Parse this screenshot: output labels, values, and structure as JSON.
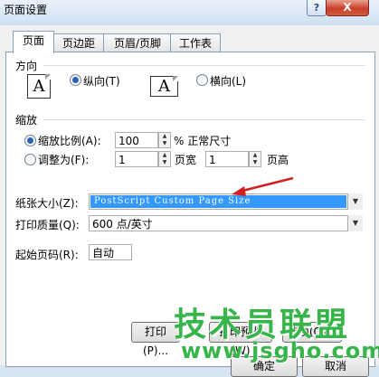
{
  "window": {
    "title": "页面设置",
    "help_label": "?",
    "close_label": "X"
  },
  "tabs": [
    {
      "label": "页面",
      "active": true
    },
    {
      "label": "页边距",
      "active": false
    },
    {
      "label": "页眉/页脚",
      "active": false
    },
    {
      "label": "工作表",
      "active": false
    }
  ],
  "orientation": {
    "group_label": "方向",
    "portrait_icon": "A",
    "portrait_label": "纵向(T)",
    "portrait_selected": true,
    "landscape_icon": "A",
    "landscape_label": "横向(L)",
    "landscape_selected": false
  },
  "scaling": {
    "group_label": "缩放",
    "adjust_label": "缩放比例(A):",
    "adjust_selected": true,
    "adjust_value": "100",
    "adjust_suffix": "% 正常尺寸",
    "fit_label": "调整为(F):",
    "fit_selected": false,
    "fit_wide_value": "1",
    "fit_wide_suffix": "页宽",
    "fit_tall_value": "1",
    "fit_tall_suffix": "页高"
  },
  "paper_size": {
    "label": "纸张大小(Z):",
    "value": "PostScript Custom Page Size"
  },
  "print_quality": {
    "label": "打印质量(Q):",
    "value": "600 点/英寸"
  },
  "first_page": {
    "label": "起始页码(R):",
    "value": "自动"
  },
  "buttons": {
    "print": "打印(P)...",
    "print_preview": "打印预览(W)",
    "options": "选项(O)...",
    "ok": "确定",
    "cancel": "取消"
  },
  "watermark": {
    "text": "技术员联盟",
    "url": "www.jsgho.com"
  },
  "colors": {
    "selection_bg": "#3399ff",
    "arrow_red": "#d42020",
    "watermark_green": "#37b54a"
  }
}
